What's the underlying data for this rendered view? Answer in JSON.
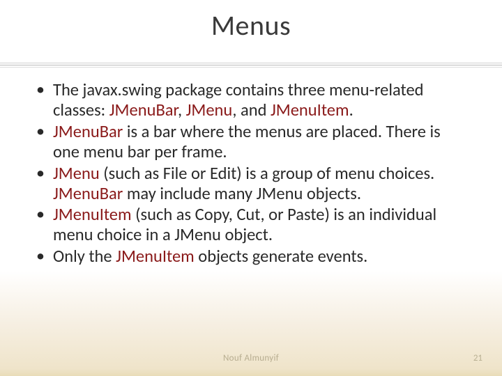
{
  "chart_data": null,
  "title": "Menus",
  "bullets": [
    {
      "pre": "The javax.swing package contains three menu-related classes: ",
      "kw1": "JMenuBar",
      "mid1": ", ",
      "kw2": "JMenu",
      "mid2": ", and ",
      "kw3": "JMenuItem",
      "post": "."
    },
    {
      "kw1": "JMenuBar",
      "post": " is a bar where the menus are placed. There is one menu bar per frame."
    },
    {
      "kw1": "JMenu",
      "mid1": " (such as File or Edit) is a group of menu choices. ",
      "kw2": "JMenuBar",
      "post": " may include many JMenu objects."
    },
    {
      "kw1": "JMenuItem",
      "post": " (such as Copy, Cut, or Paste) is an individual menu choice in a JMenu object."
    },
    {
      "pre": "Only the ",
      "kw1": "JMenuItem",
      "post": " objects generate events."
    }
  ],
  "footer_center": "Nouf Almunyif",
  "page_number": "21"
}
